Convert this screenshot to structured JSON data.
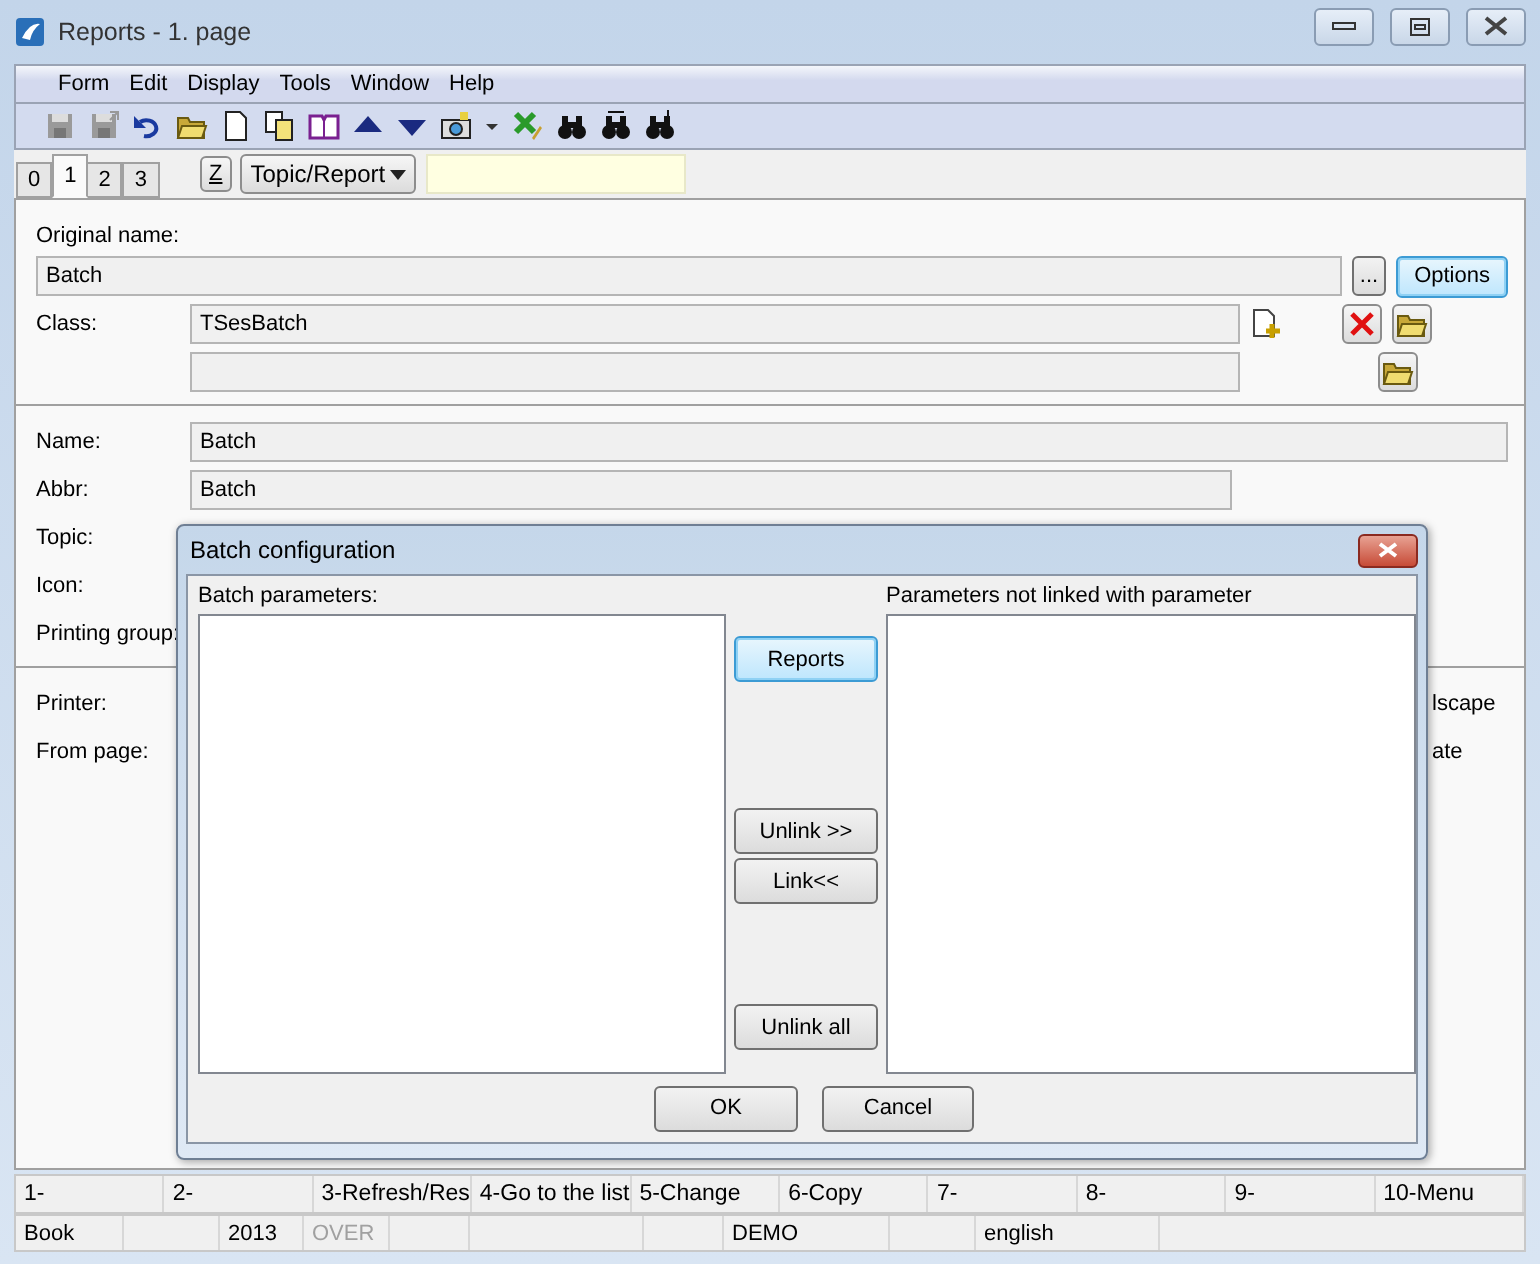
{
  "window": {
    "title": "Reports - 1. page"
  },
  "menu": [
    "Form",
    "Edit",
    "Display",
    "Tools",
    "Window",
    "Help"
  ],
  "tabs": [
    {
      "label": "0",
      "selected": false
    },
    {
      "label": "1",
      "selected": true
    },
    {
      "label": "2",
      "selected": false
    },
    {
      "label": "3",
      "selected": false
    }
  ],
  "z_button": "Z",
  "topic_dropdown": {
    "value": "Topic/Report"
  },
  "form": {
    "original_name": {
      "label": "Original name:",
      "value": "Batch"
    },
    "ellipsis_button": {
      "label": "...",
      "focused": false
    },
    "options_button": {
      "label": "Options",
      "focused": true
    },
    "class": {
      "label": "Class:",
      "value": "TSesBatch"
    },
    "name": {
      "label": "Name:",
      "value": "Batch"
    },
    "abbr": {
      "label": "Abbr:",
      "value": "Batch"
    },
    "covered_labels": [
      "Topic:",
      "Icon:",
      "Printing group:"
    ],
    "print_labels": [
      "Printer:",
      "From page:"
    ],
    "right_fragments": [
      "lscape",
      "ate"
    ]
  },
  "dialog": {
    "title": "Batch configuration",
    "left_list_label": "Batch parameters:",
    "right_list_label": "Parameters not linked with parameter",
    "buttons": [
      {
        "label": "Reports",
        "focused": true
      },
      {
        "label": "Unlink >>",
        "focused": false
      },
      {
        "label": "Link<<",
        "focused": false
      },
      {
        "label": "Unlink all",
        "focused": false
      }
    ],
    "ok": "OK",
    "cancel": "Cancel"
  },
  "function_keys": [
    "1-",
    "2-",
    "3-Refresh/Res",
    "4-Go to the list",
    "5-Change",
    "6-Copy",
    "7-",
    "8-",
    "9-",
    "10-Menu"
  ],
  "status_bar": [
    {
      "text": "Book",
      "disabled": false
    },
    {
      "text": "2013",
      "disabled": false
    },
    {
      "text": "OVER",
      "disabled": true
    },
    {
      "text": "DEMO",
      "disabled": false
    },
    {
      "text": "english",
      "disabled": false
    }
  ]
}
